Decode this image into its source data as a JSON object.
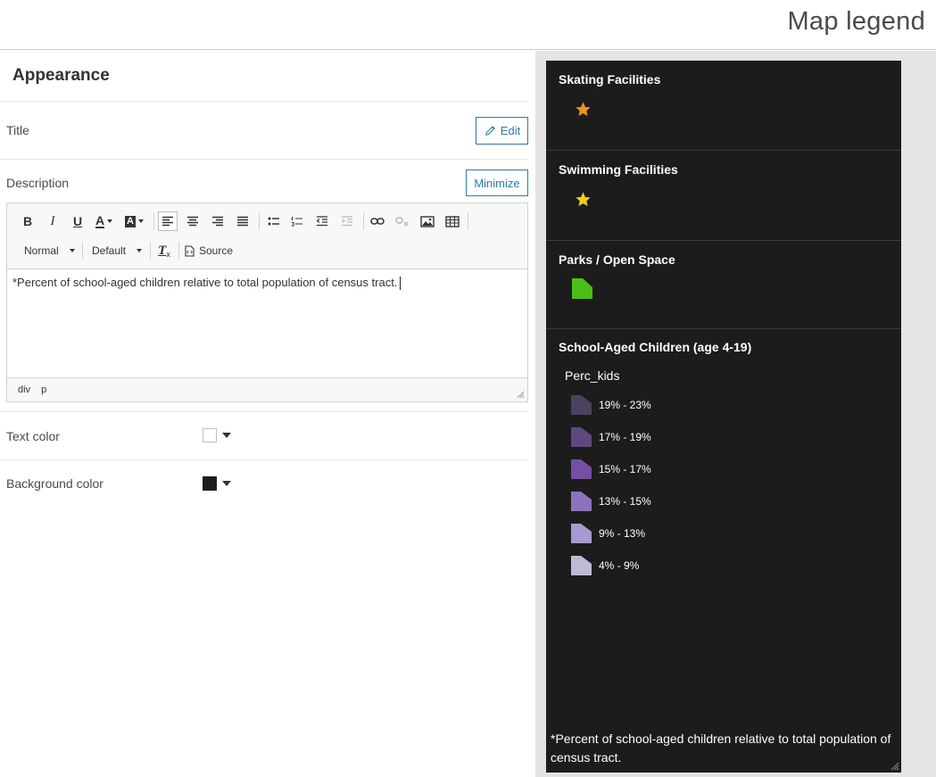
{
  "header": {
    "title": "Map legend"
  },
  "panel": {
    "heading": "Appearance",
    "title_row": {
      "label": "Title",
      "button": "Edit"
    },
    "description_row": {
      "label": "Description",
      "button": "Minimize"
    },
    "editor": {
      "toolbar": {
        "bold": "B",
        "italic": "I",
        "underline": "U",
        "text_color": "A",
        "bg_color": "A",
        "format": "Normal",
        "font": "Default",
        "clear_format": "T",
        "source": "Source"
      },
      "content": "*Percent of school-aged children relative to total population of census tract.",
      "path": [
        "div",
        "p"
      ]
    },
    "text_color": {
      "label": "Text color",
      "value": "#ffffff"
    },
    "background_color": {
      "label": "Background color",
      "value": "#1c1c1c"
    }
  },
  "legend": {
    "sections": [
      {
        "title": "Skating Facilities",
        "symbol": "star-icon",
        "color": "#f0921e"
      },
      {
        "title": "Swimming Facilities",
        "symbol": "star-icon",
        "color": "#f2cf1d"
      },
      {
        "title": "Parks / Open Space",
        "symbol": "polygon",
        "color": "#4cbd19"
      },
      {
        "title": "School-Aged Children (age 4-19)",
        "field": "Perc_kids",
        "classes": [
          {
            "label": "19% - 23%",
            "color": "#4c4160"
          },
          {
            "label": "17% - 19%",
            "color": "#60477f"
          },
          {
            "label": "15% - 17%",
            "color": "#744fa3"
          },
          {
            "label": "13% - 15%",
            "color": "#8e72bd"
          },
          {
            "label": "9% - 13%",
            "color": "#a899cf"
          },
          {
            "label": "4% - 9%",
            "color": "#bfb9d4"
          }
        ]
      }
    ],
    "description": "*Percent of school-aged children relative to total population of census tract."
  }
}
